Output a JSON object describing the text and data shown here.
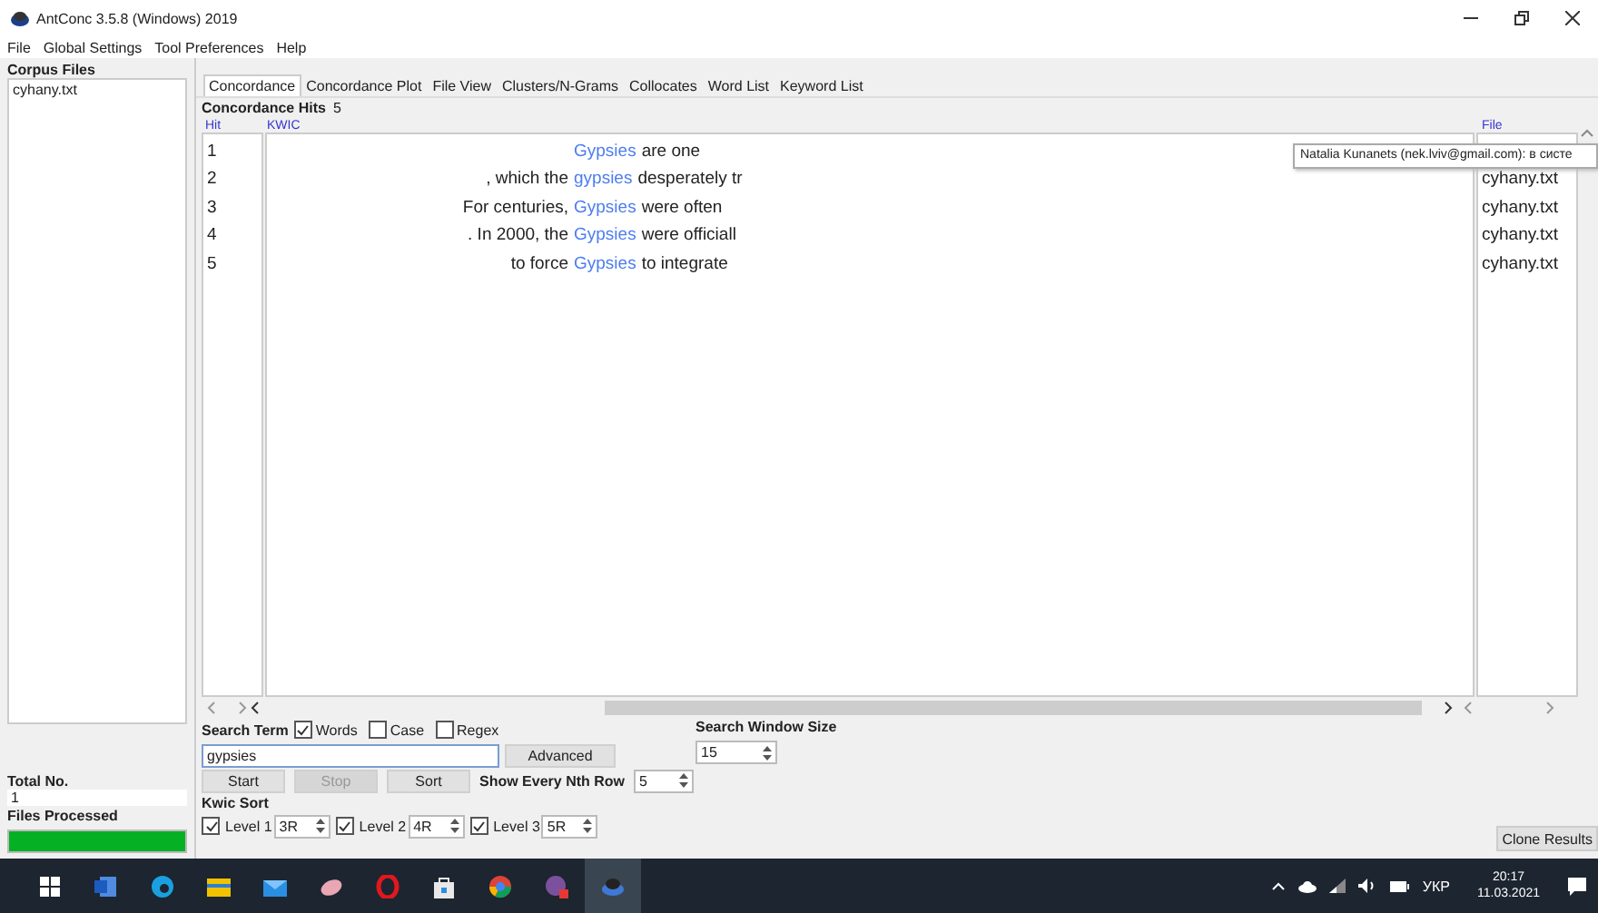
{
  "window": {
    "title": "AntConc 3.5.8 (Windows) 2019"
  },
  "menu": [
    "File",
    "Global Settings",
    "Tool Preferences",
    "Help"
  ],
  "sidebar": {
    "heading": "Corpus Files",
    "files": [
      "cyhany.txt"
    ],
    "total_label": "Total No.",
    "total_value": "1",
    "processed_label": "Files Processed",
    "progress": {
      "level": 1
    }
  },
  "tabs": [
    {
      "label": "Concordance",
      "selected": true
    },
    {
      "label": "Concordance Plot",
      "selected": false
    },
    {
      "label": "File View",
      "selected": false
    },
    {
      "label": "Clusters/N-Grams",
      "selected": false
    },
    {
      "label": "Collocates",
      "selected": false
    },
    {
      "label": "Word List",
      "selected": false
    },
    {
      "label": "Keyword List",
      "selected": false
    }
  ],
  "hits": {
    "label": "Concordance Hits",
    "count": "5"
  },
  "table": {
    "columns": [
      "Hit",
      "KWIC",
      "File"
    ],
    "rows": [
      {
        "hit": "1",
        "keyword": "Gypsies",
        "right": "are one"
      },
      {
        "hit": "2",
        "left": ", which the",
        "keyword": "gypsies",
        "right": "desperately tr",
        "file": "cyhany.txt"
      },
      {
        "hit": "3",
        "left": "For centuries,",
        "keyword": "Gypsies",
        "right": "were often",
        "file": "cyhany.txt"
      },
      {
        "hit": "4",
        "left": ". In 2000, the",
        "keyword": "Gypsies",
        "right": "were officiall",
        "file": "cyhany.txt"
      },
      {
        "hit": "5",
        "left": "to force",
        "keyword": "Gypsies",
        "right": "to integrate",
        "file": "cyhany.txt"
      }
    ]
  },
  "tooltip": "Natalia Kunanets (nek.lviv@gmail.com): в систе",
  "search": {
    "label": "Search Term",
    "options": [
      {
        "label": "Words",
        "checked": true
      },
      {
        "label": "Case",
        "checked": false
      },
      {
        "label": "Regex",
        "checked": false
      }
    ],
    "value": "gypsies",
    "advanced": "Advanced"
  },
  "window_size": {
    "label": "Search Window Size",
    "value": "15"
  },
  "buttons": [
    {
      "label": "Start",
      "disabled": false
    },
    {
      "label": "Stop",
      "disabled": true
    },
    {
      "label": "Sort",
      "disabled": false
    }
  ],
  "nth_row": {
    "label": "Show Every Nth Row",
    "value": "5"
  },
  "kwic_sort": {
    "label": "Kwic Sort",
    "levels": [
      {
        "label": "Level 1",
        "checked": true,
        "value": "3R"
      },
      {
        "label": "Level 2",
        "checked": true,
        "value": "4R"
      },
      {
        "label": "Level 3",
        "checked": true,
        "value": "5R"
      }
    ]
  },
  "clone_button": "Clone Results",
  "taskbar": {
    "language": "УКР",
    "time": "20:17",
    "date": "11.03.2021"
  }
}
